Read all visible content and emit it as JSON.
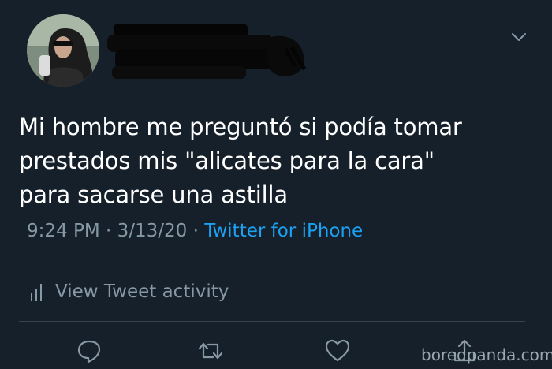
{
  "tweet": {
    "text_lines": [
      "Mi hombre me preguntó si podía tomar",
      "prestados mis \"alicates para la cara\"",
      "para sacarse una astilla"
    ],
    "time": "9:24 PM",
    "separator": "·",
    "date": "3/13/20",
    "source": "Twitter for iPhone"
  },
  "activity": {
    "label": "View Tweet activity",
    "icon": "bar-chart-icon"
  },
  "actions": [
    "reply-icon",
    "retweet-icon",
    "like-icon",
    "share-icon"
  ],
  "watermark": "boredpanda.com",
  "colors": {
    "background": "#15202b",
    "text": "#ffffff",
    "secondary": "#8899a6",
    "link": "#1da1f2",
    "divider": "#38444d"
  }
}
